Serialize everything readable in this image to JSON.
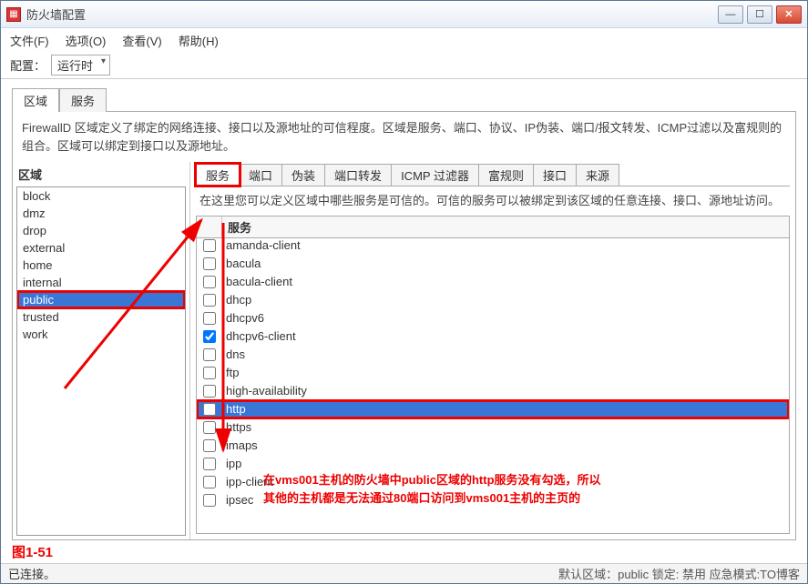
{
  "window": {
    "title": "防火墙配置"
  },
  "menu": {
    "file": "文件(F)",
    "options": "选项(O)",
    "view": "查看(V)",
    "help": "帮助(H)"
  },
  "toolbar": {
    "config_label": "配置：",
    "config_value": "运行时"
  },
  "tabs_top": {
    "zones": "区域",
    "services": "服务"
  },
  "description": "FirewallD 区域定义了绑定的网络连接、接口以及源地址的可信程度。区域是服务、端口、协议、IP伪装、端口/报文转发、ICMP过滤以及富规则的组合。区域可以绑定到接口以及源地址。",
  "zones_title": "区域",
  "zones": [
    "block",
    "dmz",
    "drop",
    "external",
    "home",
    "internal",
    "public",
    "trusted",
    "work"
  ],
  "selected_zone_index": 6,
  "subtabs": [
    "服务",
    "端口",
    "伪装",
    "端口转发",
    "ICMP 过滤器",
    "富规则",
    "接口",
    "来源"
  ],
  "active_subtab_index": 0,
  "services_hint": "在这里您可以定义区域中哪些服务是可信的。可信的服务可以被绑定到该区域的任意连接、接口、源地址访问。",
  "services_header": "服务",
  "services": [
    {
      "name": "amanda-client",
      "checked": false
    },
    {
      "name": "bacula",
      "checked": false
    },
    {
      "name": "bacula-client",
      "checked": false
    },
    {
      "name": "dhcp",
      "checked": false
    },
    {
      "name": "dhcpv6",
      "checked": false
    },
    {
      "name": "dhcpv6-client",
      "checked": true
    },
    {
      "name": "dns",
      "checked": false
    },
    {
      "name": "ftp",
      "checked": false
    },
    {
      "name": "high-availability",
      "checked": false
    },
    {
      "name": "http",
      "checked": false,
      "selected": true,
      "highlight": true
    },
    {
      "name": "https",
      "checked": false
    },
    {
      "name": "imaps",
      "checked": false
    },
    {
      "name": "ipp",
      "checked": false
    },
    {
      "name": "ipp-client",
      "checked": false
    },
    {
      "name": "ipsec",
      "checked": false
    }
  ],
  "annotation_line1": "在vms001主机的防火墙中public区域的http服务没有勾选，所以",
  "annotation_line2": "其他的主机都是无法通过80端口访问到vms001主机的主页的",
  "figure_label": "图1-51",
  "status": {
    "left": "已连接。",
    "right": "默认区域：public 锁定: 禁用 应急模式:TO博客"
  }
}
